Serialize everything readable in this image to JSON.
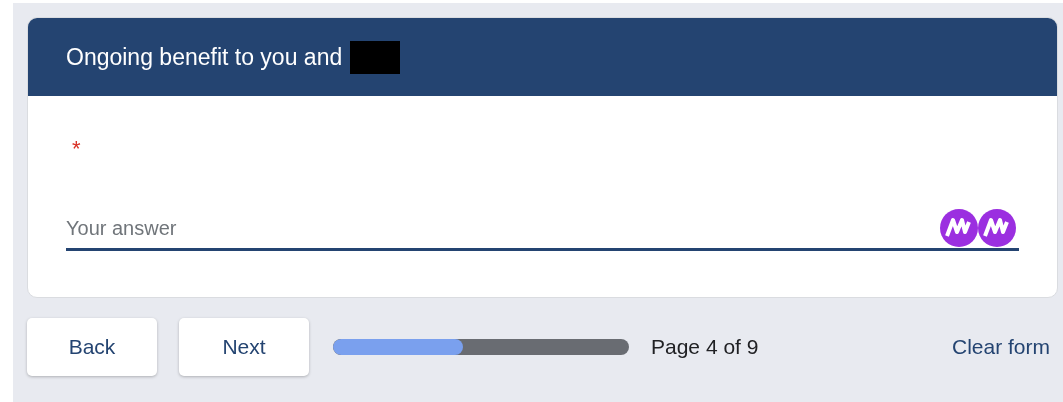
{
  "section": {
    "title": "Ongoing benefit to you and",
    "redacted": true
  },
  "question": {
    "required_mark": "*",
    "answer": {
      "placeholder": "Your answer"
    }
  },
  "footer": {
    "buttons": [
      "Back",
      "Next"
    ],
    "progress": {
      "level": 0.44,
      "label": "Page 4 of 9"
    },
    "clear_link": "Clear form"
  }
}
